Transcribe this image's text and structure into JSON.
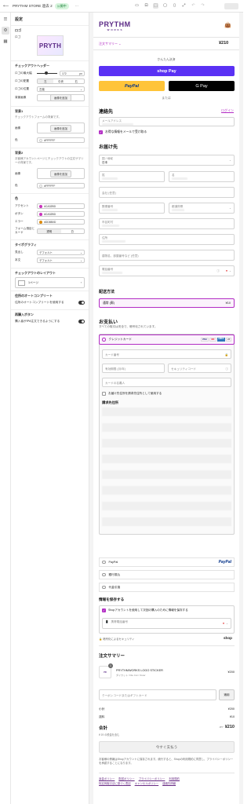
{
  "topbar": {
    "store_name": "PRYTHM STORE 過去 2",
    "status": "公開中",
    "more": "···"
  },
  "panel": {
    "title": "設定",
    "logo_section": {
      "title": "ロゴ",
      "logo_label": "ロゴ",
      "logo_text": "PRYTH"
    },
    "checkout_header": {
      "title": "チェックアウトヘッダー",
      "logo_size_label": "ロゴの最大幅",
      "logo_size_value": "172",
      "logo_size_unit": "px",
      "logo_position_label": "ロゴの配置",
      "logo_position_options": [
        "左",
        "中央",
        "右"
      ],
      "logo_position_selected": "左",
      "logo_pos_label": "ロゴの位置",
      "logo_pos_value": "左端",
      "bg_image_label": "背景画像",
      "bg_image_button": "画像を追加"
    },
    "background1": {
      "title": "背景1",
      "desc": "チェックアウトフォームの背景です。",
      "image_label": "画像",
      "image_button": "画像を追加",
      "color_label": "色",
      "color_value": "#FFFFFF"
    },
    "background2": {
      "title": "背景2",
      "desc": "お客様アカウントページとチェックアウトの注文サマリーの背景です。",
      "image_label": "画像",
      "image_button": "画像を追加",
      "color_label": "色",
      "color_value": "#FFFFFF"
    },
    "colors": {
      "title": "色",
      "accent_label": "アクセント",
      "accent_value": "#CA32BD",
      "accent_color": "#CA32BD",
      "button_label": "ボタン",
      "button_value": "#CA32BD",
      "button_color": "#CA32BD",
      "error_label": "エラー",
      "error_value": "#DD8B0D",
      "error_color": "#DD8B0D",
      "form_label": "フォーム項目とカード",
      "form_options": [
        "透明",
        "白"
      ],
      "form_selected": "透明"
    },
    "typography": {
      "title": "タイポグラフィ",
      "heading_label": "見出し",
      "heading_value": "デフォルト",
      "body_label": "本文",
      "body_value": "デフォルト"
    },
    "layout": {
      "title": "チェックアウトのレイアウト",
      "option": "1ページ"
    },
    "autocomplete": {
      "title": "住所のオートコンプリート",
      "label": "住所のオートコンプリートを使用する"
    },
    "buy_button": {
      "title": "再購入ボタン",
      "label": "購入者がIPA注文できるようにする"
    }
  },
  "main": {
    "brand": "PRYTHM",
    "brand_sub": "W O R K S",
    "order_summary_toggle": "注文サマリー",
    "order_total_top": "¥210",
    "express_label": "かんたん決済",
    "shop_pay": "shop Pay",
    "paypal": "PayPal",
    "gpay": "G Pay",
    "or_label": "または",
    "contact_heading": "連絡先",
    "login_link": "ログイン",
    "email_placeholder": "メールアドレス",
    "newsletter_label": "お得な情報をメールで受け取る",
    "delivery_heading": "お届け先",
    "country_label": "国 / 地域",
    "country_value": "日本",
    "last_name": "姓",
    "first_name": "名",
    "company": "会社 (任意)",
    "postal": "郵便番号",
    "prefecture": "都道府県",
    "city": "市区町村",
    "address": "住所",
    "building": "建物名、部屋番号など (任意)",
    "phone": "電話番号",
    "shipping_heading": "配送方法",
    "shipping_option": "通常 (郵)",
    "shipping_price": "¥10",
    "payment_heading": "お支払い",
    "payment_desc": "すべての取引は安全で、暗号化されています。",
    "card_option": "クレジットカード",
    "card_brands": [
      "VISA",
      "MC",
      "AMEX",
      "+5"
    ],
    "card_number": "カード番号",
    "expiry": "有効期限 (月/年)",
    "cvv": "セキュリティコード",
    "card_name": "カードの名義人",
    "use_shipping_as_billing": "お届け先住所を請求先住所として使用する",
    "billing_heading": "請求先住所",
    "paypal_option": "PayPal",
    "paypal_logo": "PayPal",
    "bank_option": "銀行振込",
    "cod_option": "代金引換",
    "remember_heading": "情報を保存する",
    "remember_label": "Shopアカウントを使用して次回の購入のために情報を保存する",
    "mobile_placeholder": "携帯電話番号",
    "secure_label": "暗号化によるセキュリティ",
    "shop_label": "shop",
    "summary_heading": "注文サマリー",
    "product_name": "PRYTHMWORKS LOGO STICKER",
    "product_variant": "ダイカット / Die Cut / Outer",
    "product_qty": "1",
    "product_price": "¥200",
    "discount_placeholder": "クーポンコードまたはギフトカード",
    "apply_button": "適用",
    "subtotal_label": "小計",
    "subtotal_value": "¥200",
    "shipping_label": "送料",
    "shipping_value": "¥10",
    "total_label": "合計",
    "total_currency": "JPY",
    "total_value": "¥210",
    "tax_note": "¥ 19 の税金を含む",
    "pay_now": "今すぐ支払う",
    "terms_text": "お客様の情報はShopアカウントに保存されます。続行すると、Shopの利用規約に同意し、プライバシーポリシーを承認することになります。",
    "footer_links": [
      "返金ポリシー",
      "配送ポリシー",
      "プライバシーポリシー",
      "利用規約",
      "特定商取引法に基づく表記",
      "キャンセルポリシー",
      "連絡先情報"
    ]
  }
}
